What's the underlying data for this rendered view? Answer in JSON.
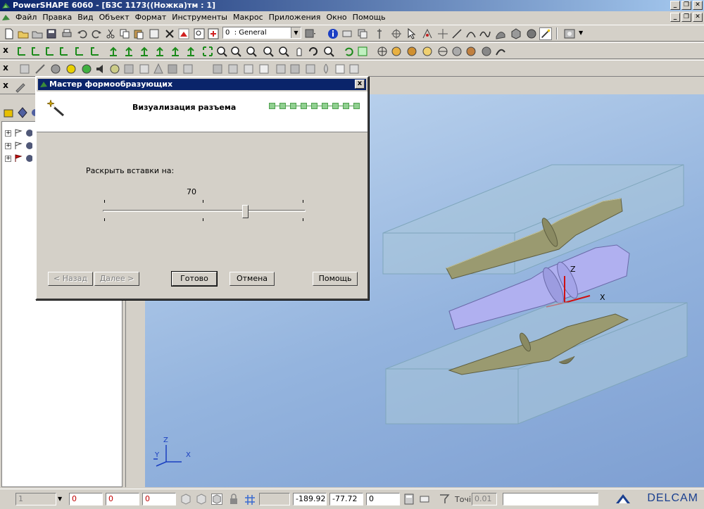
{
  "window": {
    "title": "PowerSHAPE 6060 - [БЗС 1173((Ножка)тм : 1]",
    "minimize": "_",
    "restore": "❐",
    "close": "✕"
  },
  "menu": [
    "Файл",
    "Правка",
    "Вид",
    "Объект",
    "Формат",
    "Инструменты",
    "Макрос",
    "Приложения",
    "Окно",
    "Помощь"
  ],
  "toolbar": {
    "level_value": "0",
    "level_name": ": General",
    "toolbar_close": "x"
  },
  "dialog": {
    "title": "Мастер формообразующих",
    "step_title": "Визуализация разъема",
    "progress_steps": 9,
    "label": "Раскрыть вставки на:",
    "slider_value": "70",
    "slider_fraction": 0.7,
    "close": "x",
    "buttons": {
      "back": "< Назад",
      "next": "Далее >",
      "finish": "Готово",
      "cancel": "Отмена",
      "help": "Помощь"
    }
  },
  "viewport": {
    "axis_x": "X",
    "axis_y": "Y",
    "axis_z": "Z",
    "part_axis_x": "X",
    "part_axis_z": "Z"
  },
  "statusbar": {
    "field1": "1",
    "field2": "0",
    "field3": "0",
    "field4": "0",
    "coord_x": "-189.92",
    "coord_y": "-77.72",
    "coord_z": "0",
    "tolerance_label": "Точі",
    "tolerance_value": "0.01",
    "logo": "DELCAM"
  },
  "colors": {
    "title_bar": "#0a246a",
    "viewport_top": "#c2d8f0",
    "viewport_bottom": "#7e9fd2",
    "part_core": "#b0b0f0",
    "part_cavity": "#9a9a70",
    "axis_red": "#d01010"
  }
}
